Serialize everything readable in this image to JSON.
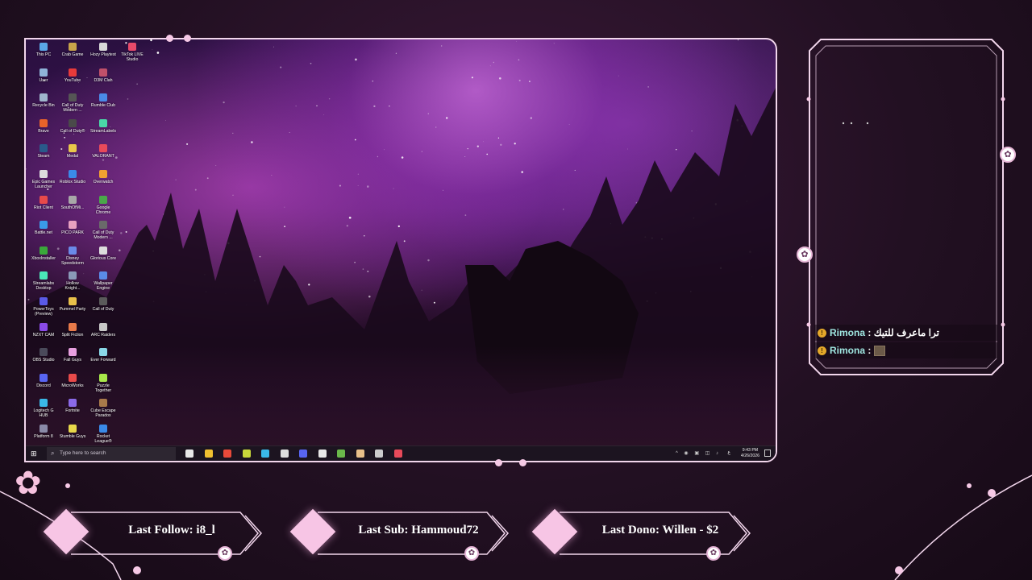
{
  "desktop": {
    "icons": [
      {
        "label": "This PC",
        "color": "#5aa7e6"
      },
      {
        "label": "Crab Game",
        "color": "#c8a44a"
      },
      {
        "label": "Hozy Playtest",
        "color": "#d8d8d8"
      },
      {
        "label": "TikTok LIVE Studio",
        "color": "#e84a6a"
      },
      {
        "label": "User",
        "color": "#8fb3d8"
      },
      {
        "label": "YouTube",
        "color": "#e83a3a"
      },
      {
        "label": "D3M Clah",
        "color": "#c0506a"
      },
      {
        "label": "Recycle Bin",
        "color": "#9fb6cc"
      },
      {
        "label": "Call of Duty Modern ...",
        "color": "#555555"
      },
      {
        "label": "Rumble Club",
        "color": "#4a8ae8"
      },
      {
        "label": "Brave",
        "color": "#e8632a"
      },
      {
        "label": "Call of Duty®",
        "color": "#4a4a4a"
      },
      {
        "label": "StreamLabels",
        "color": "#4ad8a8"
      },
      {
        "label": "Steam",
        "color": "#2a5a8a"
      },
      {
        "label": "Medal",
        "color": "#e8c84a"
      },
      {
        "label": "VALORANT",
        "color": "#e84a5a"
      },
      {
        "label": "Epic Games Launcher",
        "color": "#dddddd"
      },
      {
        "label": "Roblox Studio",
        "color": "#3a8ae8"
      },
      {
        "label": "Overwatch",
        "color": "#f0a030"
      },
      {
        "label": "Riot Client",
        "color": "#e84a4a"
      },
      {
        "label": "SouthOfMi...",
        "color": "#a8a8a8"
      },
      {
        "label": "Google Chrome",
        "color": "#4aa84a"
      },
      {
        "label": "Battle.net",
        "color": "#3a9ae8"
      },
      {
        "label": "PICO PARK",
        "color": "#e8a0c0"
      },
      {
        "label": "Call of Duty Modern ...",
        "color": "#6a6a6a"
      },
      {
        "label": "XboxInstaller",
        "color": "#3aa83a"
      },
      {
        "label": "Disney Speedstorm",
        "color": "#6a8ae8"
      },
      {
        "label": "Glorious Core",
        "color": "#dddddd"
      },
      {
        "label": "Streamlabs Desktop",
        "color": "#4ae8b8"
      },
      {
        "label": "Hollow Knight...",
        "color": "#8a9ab8"
      },
      {
        "label": "Wallpaper Engine",
        "color": "#5a8ae8"
      },
      {
        "label": "PowerToys (Preview)",
        "color": "#5a5ae8"
      },
      {
        "label": "Pummel Party",
        "color": "#e8c04a"
      },
      {
        "label": "Call of Duty",
        "color": "#5a5a5a"
      },
      {
        "label": "NZXT CAM",
        "color": "#8a4ae8"
      },
      {
        "label": "Split Fiction",
        "color": "#e87a4a"
      },
      {
        "label": "ARC Raiders",
        "color": "#c8c8c8"
      },
      {
        "label": "OBS Studio",
        "color": "#4a4a5a"
      },
      {
        "label": "Fall Guys",
        "color": "#e8a0e0"
      },
      {
        "label": "Ever Forward",
        "color": "#8ad8e8"
      },
      {
        "label": "Discord",
        "color": "#5865f2"
      },
      {
        "label": "MicroWorks",
        "color": "#e84a4a"
      },
      {
        "label": "Puzzle Together",
        "color": "#a8e84a"
      },
      {
        "label": "Logitech G HUB",
        "color": "#3ab8e8"
      },
      {
        "label": "Fortnite",
        "color": "#8a6ae8"
      },
      {
        "label": "Cube Escape Paradox",
        "color": "#a87a4a"
      },
      {
        "label": "Platform 8",
        "color": "#8a8aa8"
      },
      {
        "label": "Stumble Guys",
        "color": "#e8d84a"
      },
      {
        "label": "Rocket League®",
        "color": "#3a8ae8"
      }
    ],
    "taskbar": {
      "search_placeholder": "Type here to search",
      "time": "9:43 PM",
      "date": "4/26/2026",
      "lang": "ع",
      "pinned_colors": [
        "#e8e8e8",
        "#f0c030",
        "#e84a3a",
        "#c8d83a",
        "#3ab8e8",
        "#dddddd",
        "#5865f2",
        "#e8e8e8",
        "#6ab84a",
        "#e8c08a",
        "#cccccc",
        "#e84a5a"
      ]
    }
  },
  "chat": {
    "messages": [
      {
        "user": "Rimona",
        "sep": " : ",
        "text": "ترا ماعرف للتيك"
      },
      {
        "user": "Rimona",
        "sep": " : ",
        "text": ""
      }
    ]
  },
  "alerts": {
    "follow": "Last Follow: i8_l",
    "sub": "Last Sub: Hammoud72",
    "dono": "Last Dono: Willen - $2"
  },
  "colors": {
    "frame": "#f2d6ec",
    "accent": "#f7c5e5",
    "badge": "#e4a82a",
    "username": "#9fe6e0"
  }
}
